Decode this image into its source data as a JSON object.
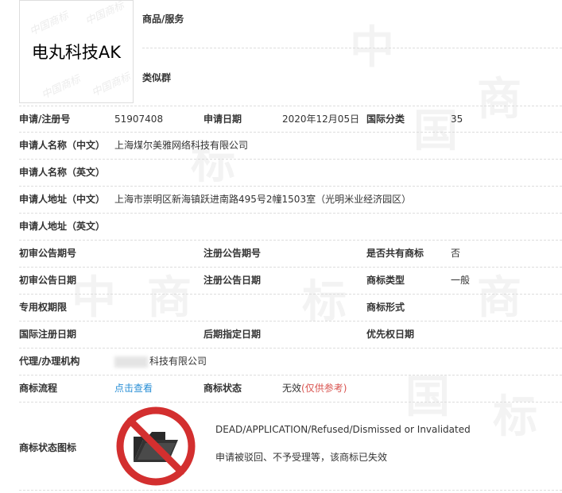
{
  "watermark_char_1": "中",
  "watermark_char_2": "国",
  "watermark_char_3": "商",
  "watermark_char_4": "标",
  "logo": {
    "text": "电丸科技AK",
    "wm_text": "中国商标"
  },
  "top": {
    "goods_label": "商品/服务",
    "similar_group_label": "类似群"
  },
  "rows": {
    "reg": {
      "label_regno": "申请/注册号",
      "regno": "51907408",
      "label_date": "申请日期",
      "date": "2020年12月05日",
      "label_class": "国际分类",
      "class": "35"
    },
    "name_cn": {
      "label": "申请人名称（中文）",
      "value": "上海煤尔美雅网络科技有限公司"
    },
    "name_en": {
      "label": "申请人名称（英文）",
      "value": ""
    },
    "addr_cn": {
      "label": "申请人地址（中文）",
      "value": "上海市崇明区新海镇跃进南路495号2幢1503室（光明米业经济园区）"
    },
    "addr_en": {
      "label": "申请人地址（英文）",
      "value": ""
    },
    "pub": {
      "label_first": "初审公告期号",
      "label_reg": "注册公告期号",
      "label_shared": "是否共有商标",
      "shared": "否"
    },
    "pubdate": {
      "label_first": "初审公告日期",
      "label_reg": "注册公告日期",
      "label_type": "商标类型",
      "type": "一般"
    },
    "excl": {
      "label_period": "专用权期限",
      "label_form": "商标形式"
    },
    "intl": {
      "label_intl": "国际注册日期",
      "label_later": "后期指定日期",
      "label_priority": "优先权日期"
    },
    "agent": {
      "label": "代理/办理机构",
      "value": "科技有限公司"
    },
    "flow": {
      "label_flow": "商标流程",
      "link": "点击查看",
      "label_status": "商标状态",
      "status": "无效",
      "note": "(仅供参考)"
    }
  },
  "status_icon": {
    "label": "商标状态图标",
    "icon": "no-folder-prohibited-icon",
    "line1": "DEAD/APPLICATION/Refused/Dismissed or Invalidated",
    "line2": "申请被驳回、不予受理等，该商标已失效"
  },
  "colors": {
    "link": "#2a8fd6",
    "status_note": "#d9534f",
    "prohibit": "#d32f2f"
  }
}
